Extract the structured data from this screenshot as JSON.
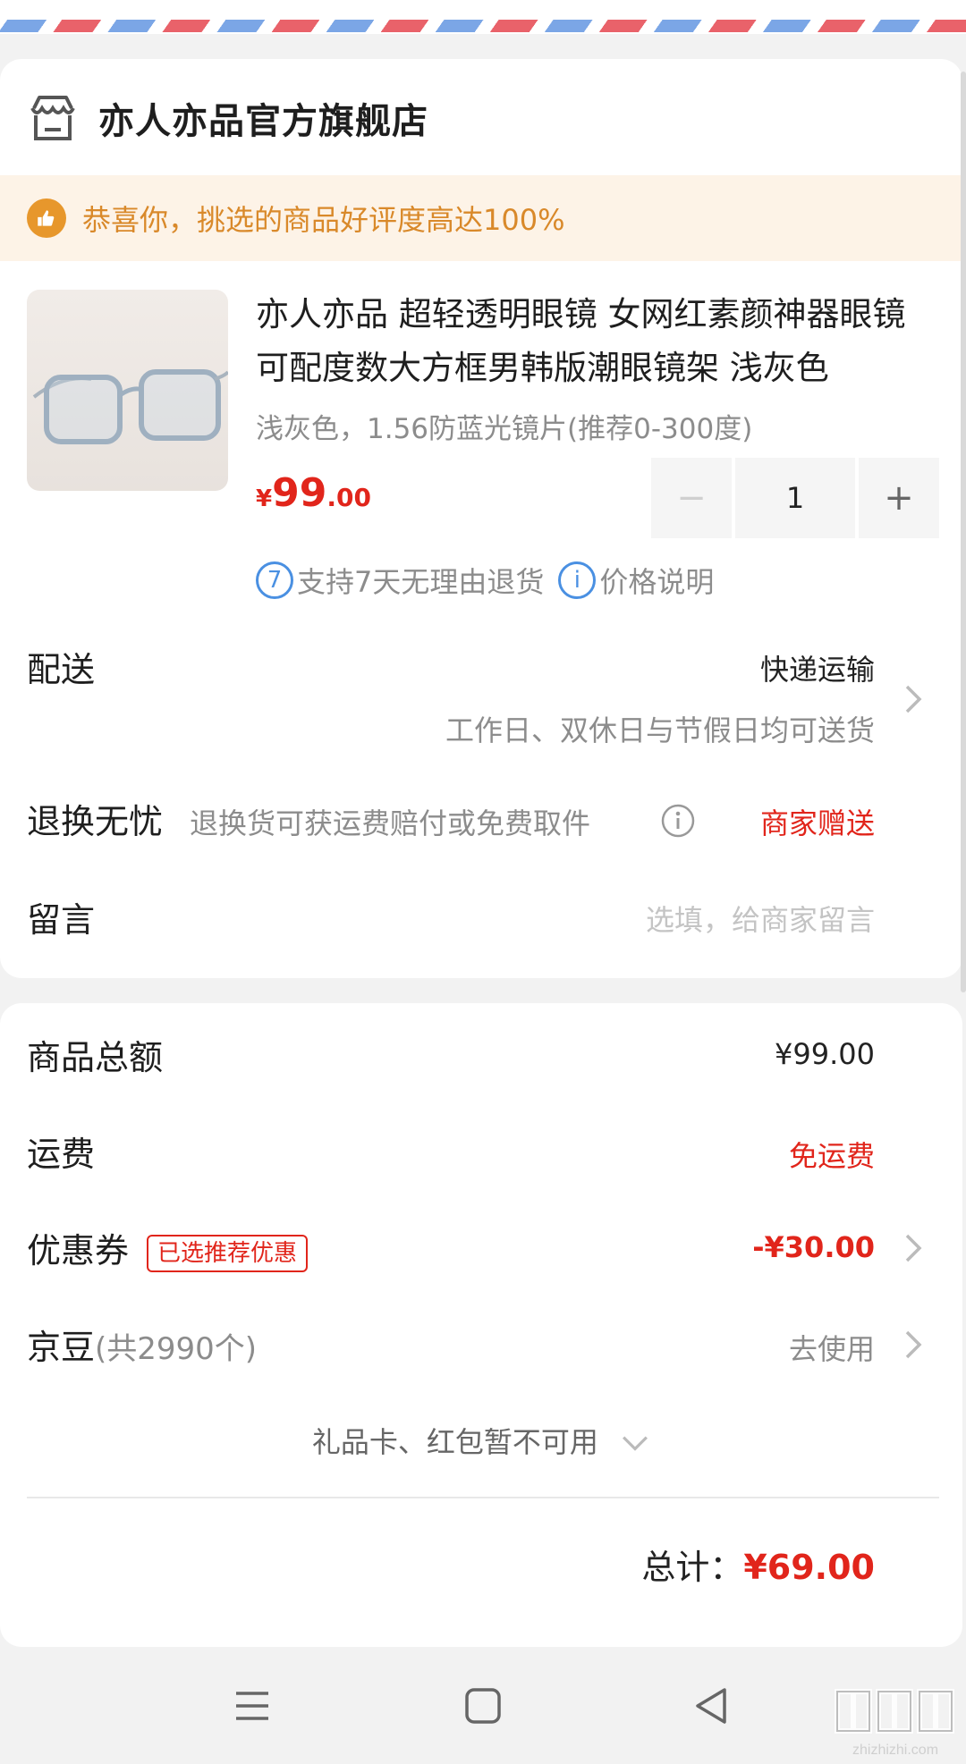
{
  "shop": {
    "name": "亦人亦品官方旗舰店",
    "icon": "store-icon"
  },
  "notice": {
    "text": "恭喜你，挑选的商品好评度高达100%",
    "icon": "thumbs-up-icon",
    "color": "#e7972c"
  },
  "product": {
    "title": "亦人亦品 超轻透明眼镜 女网红素颜神器眼镜可配度数大方框男韩版潮眼镜架 浅灰色",
    "spec": "浅灰色，1.56防蓝光镜片(推荐0-300度)",
    "price": {
      "currency": "¥",
      "integer": "99",
      "decimal": ".00"
    },
    "quantity": "1",
    "minus": "−",
    "plus": "+",
    "services": [
      {
        "icon": "7",
        "label": "支持7天无理由退货"
      },
      {
        "icon": "i",
        "label": "价格说明"
      }
    ]
  },
  "delivery": {
    "label": "配送",
    "method": "快递运输",
    "detail": "工作日、双休日与节假日均可送货"
  },
  "returns": {
    "label": "退换无忧",
    "desc": "退换货可获运费赔付或免费取件",
    "value": "商家赠送"
  },
  "message": {
    "label": "留言",
    "placeholder": "选填，给商家留言"
  },
  "summary": {
    "goods_total": {
      "label": "商品总额",
      "value": "¥99.00"
    },
    "shipping": {
      "label": "运费",
      "value": "免运费"
    },
    "coupon": {
      "label": "优惠券",
      "tag": "已选推荐优惠",
      "value": "-¥30.00"
    },
    "jingdou": {
      "label": "京豆",
      "count": "(共2990个)",
      "value": "去使用"
    },
    "gift_note": "礼品卡、红包暂不可用",
    "total_label": "总计：",
    "total_value": "¥69.00"
  },
  "colors": {
    "accent_red": "#e1251b",
    "notice_orange": "#d9892a",
    "service_blue": "#4a90e2"
  },
  "watermark": {
    "sub": "zhizhizhi.com"
  }
}
